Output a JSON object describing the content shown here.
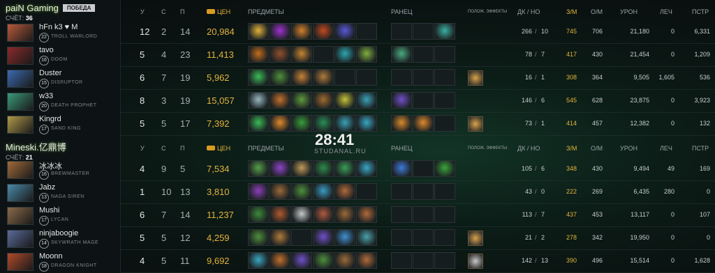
{
  "teams": [
    {
      "name": "paiN Gaming",
      "badge": "ПОБЕДА",
      "score_label": "СЧЁТ:",
      "score": "36",
      "players": [
        {
          "name": "hFn k3 ♥ M",
          "level": "22",
          "hero": "TROLL WARLORD",
          "k": "12",
          "d": "2",
          "a": "14",
          "nw": "20,984",
          "lh": "266",
          "dn": "10",
          "gpm": "745",
          "xpm": "706",
          "dmg": "21,180",
          "heal": "0",
          "td": "6,331",
          "items": [
            "#e1b23b",
            "#a030d0",
            "#d2802c",
            "#c34a1e",
            "#5a58d8",
            "empty"
          ],
          "backpack": [
            "empty",
            "empty",
            "#3bb0a3"
          ],
          "neutral": ""
        },
        {
          "name": "tavo",
          "level": "16",
          "hero": "DOOM",
          "k": "5",
          "d": "4",
          "a": "23",
          "nw": "11,413",
          "lh": "78",
          "dn": "7",
          "gpm": "417",
          "xpm": "430",
          "dmg": "21,454",
          "heal": "0",
          "td": "1,209",
          "items": [
            "#c26c1c",
            "#8f4f2d",
            "#c58431",
            "empty",
            "#2ca6b0",
            "#7fae3e"
          ],
          "backpack": [
            "#4aa97f",
            "empty",
            "empty"
          ],
          "neutral": ""
        },
        {
          "name": "Duster",
          "level": "15",
          "hero": "DISRUPTOR",
          "k": "6",
          "d": "7",
          "a": "19",
          "nw": "5,962",
          "lh": "16",
          "dn": "1",
          "gpm": "308",
          "xpm": "364",
          "dmg": "9,505",
          "heal": "1,605",
          "td": "536",
          "items": [
            "#3bbb57",
            "#4e8f3b",
            "#c68237",
            "#b07a3b",
            "empty",
            "empty"
          ],
          "backpack": [
            "empty",
            "empty",
            "empty"
          ],
          "neutral": "#d9a24a"
        },
        {
          "name": "w33",
          "level": "20",
          "hero": "DEATH PROPHET",
          "k": "8",
          "d": "3",
          "a": "19",
          "nw": "15,057",
          "lh": "146",
          "dn": "6",
          "gpm": "545",
          "xpm": "628",
          "dmg": "23,875",
          "heal": "0",
          "td": "3,923",
          "items": [
            "#96b8c0",
            "#c4702c",
            "#5e9a3d",
            "#9f6a2e",
            "#c4c23a",
            "#3aa0b5"
          ],
          "backpack": [
            "#7050c8",
            "empty",
            "empty"
          ],
          "neutral": ""
        },
        {
          "name": "Kingrd",
          "level": "17",
          "hero": "SAND KING",
          "k": "5",
          "d": "5",
          "a": "17",
          "nw": "7,392",
          "lh": "73",
          "dn": "1",
          "gpm": "414",
          "xpm": "457",
          "dmg": "12,382",
          "heal": "0",
          "td": "132",
          "items": [
            "#3bbb57",
            "#e08a2c",
            "#3a9c3a",
            "#2a8c56",
            "#3aa0b5",
            "#3aa6c2"
          ],
          "backpack": [
            "#d88a2c",
            "#e08a2c",
            "empty"
          ],
          "neutral": "#d9a24a"
        }
      ]
    },
    {
      "name": "Mineski.亿鼎博",
      "badge": "",
      "score_label": "СЧЁТ:",
      "score": "21",
      "players": [
        {
          "name": "冰冰冰",
          "level": "16",
          "hero": "BREWMASTER",
          "k": "4",
          "d": "9",
          "a": "5",
          "nw": "7,534",
          "lh": "105",
          "dn": "6",
          "gpm": "348",
          "xpm": "430",
          "dmg": "9,494",
          "heal": "49",
          "td": "169",
          "items": [
            "#56a04a",
            "#8e44c8",
            "#bf9a5a",
            "#2e8a4a",
            "#3a9d56",
            "#3aa6c2"
          ],
          "backpack": [
            "#3e7ad8",
            "empty",
            "#3aa63a"
          ],
          "neutral": ""
        },
        {
          "name": "Jabz",
          "level": "13",
          "hero": "NAGA SIREN",
          "k": "1",
          "d": "10",
          "a": "13",
          "nw": "3,810",
          "lh": "43",
          "dn": "0",
          "gpm": "222",
          "xpm": "269",
          "dmg": "6,435",
          "heal": "280",
          "td": "0",
          "items": [
            "#8c3fb8",
            "#9a6a3a",
            "#4e8f3b",
            "#3a9cc2",
            "#b06a3a",
            "empty"
          ],
          "backpack": [
            "empty",
            "empty",
            "empty"
          ],
          "neutral": ""
        },
        {
          "name": "Mushi",
          "level": "17",
          "hero": "LYCAN",
          "k": "6",
          "d": "7",
          "a": "14",
          "nw": "11,237",
          "lh": "113",
          "dn": "7",
          "gpm": "437",
          "xpm": "453",
          "dmg": "13,117",
          "heal": "0",
          "td": "107",
          "items": [
            "#3e8a3a",
            "#b05a2e",
            "#c7c7c7",
            "#b05a40",
            "#9a6a3a",
            "#b06a3a"
          ],
          "backpack": [
            "empty",
            "empty",
            "empty"
          ],
          "neutral": ""
        },
        {
          "name": "ninjaboogie",
          "level": "14",
          "hero": "SKYWRATH MAGE",
          "k": "5",
          "d": "5",
          "a": "12",
          "nw": "4,259",
          "lh": "21",
          "dn": "2",
          "gpm": "278",
          "xpm": "342",
          "dmg": "19,950",
          "heal": "0",
          "td": "0",
          "items": [
            "#4e8f3b",
            "#b07a3b",
            "empty",
            "#7050c8",
            "#4090d0",
            "#4aa0a8"
          ],
          "backpack": [
            "empty",
            "empty",
            "empty"
          ],
          "neutral": "#d9a24a"
        },
        {
          "name": "Moonn",
          "level": "18",
          "hero": "DRAGON KNIGHT",
          "k": "4",
          "d": "5",
          "a": "11",
          "nw": "9,692",
          "lh": "142",
          "dn": "13",
          "gpm": "390",
          "xpm": "496",
          "dmg": "15,514",
          "heal": "0",
          "td": "1,628",
          "items": [
            "#3aa6c2",
            "#c4702c",
            "#7050c8",
            "#4e8f3b",
            "#9a6a3a",
            "#b06a3a"
          ],
          "backpack": [
            "empty",
            "empty",
            "empty"
          ],
          "neutral": "#c7c7c7"
        }
      ]
    }
  ],
  "headers": {
    "k": "У",
    "d": "С",
    "a": "П",
    "nw": "ЦЕН",
    "items": "ПРЕДМЕТЫ",
    "backpack": "РАНЕЦ",
    "neutral": "ПОЛОЖ. ЭФФЕКТЫ",
    "lhdn": "ДК / НО",
    "gpm": "З/М",
    "xpm": "О/М",
    "dmg": "УРОН",
    "heal": "ЛЕЧ",
    "td": "ПСТР"
  },
  "timer": "28:41",
  "site": "STUDANAL.RU",
  "colors": {
    "accent_gold": "#e2b43c",
    "win_glow": "#5f9c3b"
  }
}
